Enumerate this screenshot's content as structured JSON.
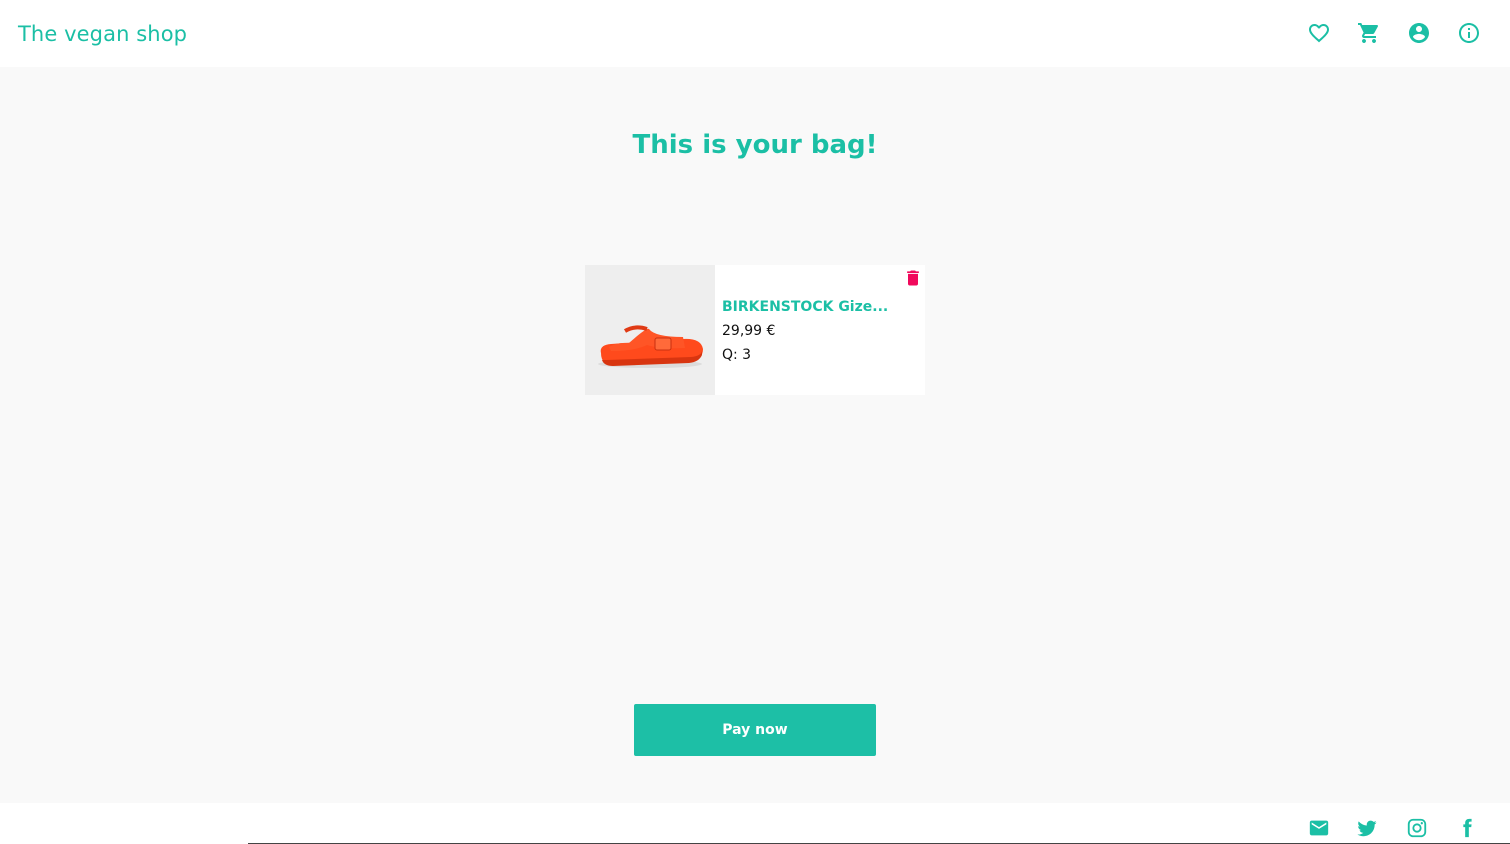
{
  "header": {
    "brand": "The vegan shop",
    "icons": [
      "heart-icon",
      "cart-icon",
      "account-icon",
      "info-icon"
    ]
  },
  "main": {
    "title": "This is your bag!",
    "items": [
      {
        "name": "BIRKENSTOCK Gize...",
        "price": "29,99 €",
        "quantity": "Q: 3",
        "image": "orange-sandal"
      }
    ],
    "pay_label": "Pay now"
  },
  "footer": {
    "icons": [
      "mail-icon",
      "twitter-icon",
      "instagram-icon",
      "facebook-icon"
    ]
  },
  "colors": {
    "accent": "#1bbfa5",
    "delete": "#f0095c",
    "background": "#f9f9f9"
  }
}
